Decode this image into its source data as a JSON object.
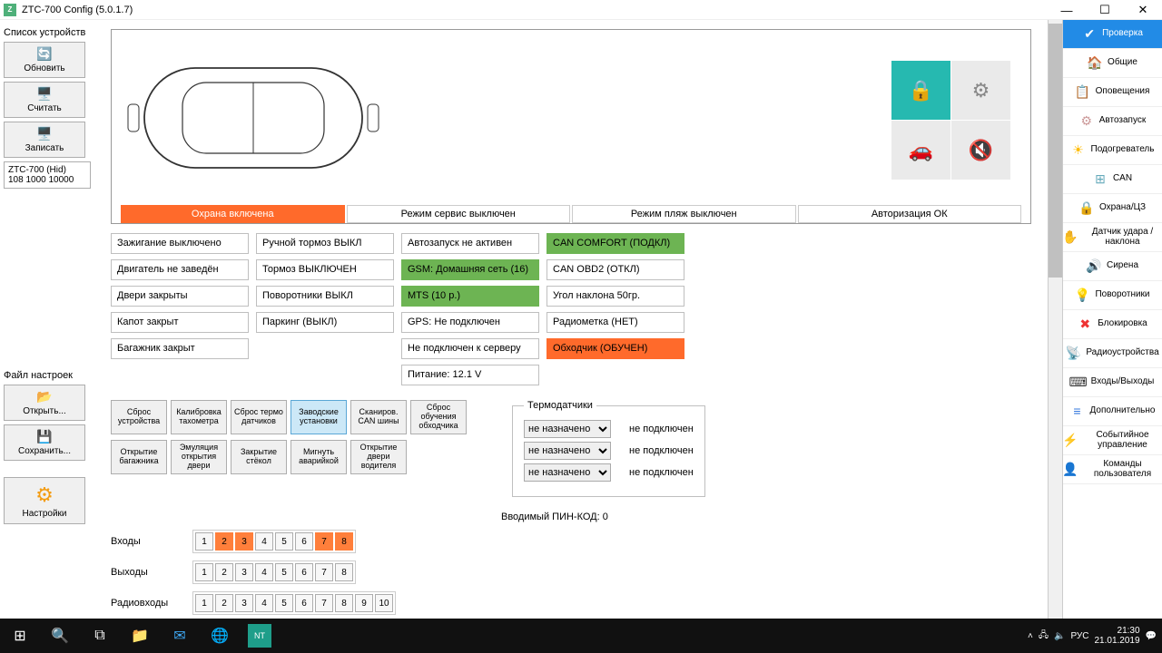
{
  "title": "ZTC-700 Config  (5.0.1.7)",
  "left": {
    "devices_label": "Список устройств",
    "refresh": "Обновить",
    "read": "Считать",
    "write": "Записать",
    "device_line1": "ZTC-700  (Hid)",
    "device_line2": "108 1000 10000",
    "settings_file": "Файл настроек",
    "open": "Открыть...",
    "save": "Сохранить...",
    "settings": "Настройки"
  },
  "tiles": {
    "lock": "🔒",
    "engine": "⚙",
    "car": "🚗",
    "mute": "🔇"
  },
  "status_strip": [
    "Охрана включена",
    "Режим сервис выключен",
    "Режим пляж выключен",
    "Авторизация ОК"
  ],
  "grid": {
    "c0": [
      "Зажигание выключено",
      "Двигатель не заведён",
      "Двери закрыты",
      "Капот закрыт",
      "Багажник закрыт"
    ],
    "c1": [
      "Ручной тормоз ВЫКЛ",
      "Тормоз ВЫКЛЮЧЕН",
      "Поворотники ВЫКЛ",
      "Паркинг (ВЫКЛ)"
    ],
    "c2": [
      "Автозапуск не активен",
      "GSM: Домашняя сеть (16)",
      "MTS (10 р.)",
      "GPS: Не подключен",
      "Не подключен к серверу",
      "Питание: 12.1 V"
    ],
    "c3": [
      "CAN COMFORT (ПОДКЛ)",
      "CAN OBD2 (ОТКЛ)",
      "Угол наклона 50гр.",
      "Радиометка (НЕТ)",
      "Обходчик (ОБУЧЕН)"
    ]
  },
  "actions": {
    "row1": [
      "Сброс устройства",
      "Калибровка тахометра",
      "Сброс термо датчиков",
      "Заводские установки",
      "Сканиров. CAN шины",
      "Сброс обучения обходчика"
    ],
    "row2": [
      "Открытие багажника",
      "Эмуляция открытия двери",
      "Закрытие стёкол",
      "Мигнуть аварийкой",
      "Открытие двери водителя"
    ]
  },
  "thermo": {
    "title": "Термодатчики",
    "option": "не назначено",
    "value": "не подключен"
  },
  "pin_label": "Вводимый ПИН-КОД: 0",
  "io": {
    "inputs": "Входы",
    "outputs": "Выходы",
    "radio": "Радиовходы",
    "in_states": [
      0,
      1,
      1,
      0,
      0,
      0,
      1,
      1
    ],
    "out_states": [
      0,
      0,
      0,
      0,
      0,
      0,
      0,
      0
    ],
    "radio_count": 10
  },
  "right_nav": [
    {
      "label": "Проверка",
      "icon": "✔",
      "active": true,
      "color": "#fff"
    },
    {
      "label": "Общие",
      "icon": "🏠",
      "color": "#e08"
    },
    {
      "label": "Оповещения",
      "icon": "📋",
      "color": "#59a"
    },
    {
      "label": "Автозапуск",
      "icon": "⚙",
      "color": "#c99"
    },
    {
      "label": "Подогреватель",
      "icon": "☀",
      "color": "#fb0"
    },
    {
      "label": "CAN",
      "icon": "⊞",
      "color": "#6ab"
    },
    {
      "label": "Охрана/ЦЗ",
      "icon": "🔒",
      "color": "#f90"
    },
    {
      "label": "Датчик удара / наклона",
      "icon": "✋",
      "color": "#eca"
    },
    {
      "label": "Сирена",
      "icon": "🔊",
      "color": "#6ab"
    },
    {
      "label": "Поворотники",
      "icon": "💡",
      "color": "#fc0"
    },
    {
      "label": "Блокировка",
      "icon": "✖",
      "color": "#e33"
    },
    {
      "label": "Радиоустройства",
      "icon": "📡",
      "color": "#555"
    },
    {
      "label": "Входы/Выходы",
      "icon": "⌨",
      "color": "#333"
    },
    {
      "label": "Дополнительно",
      "icon": "≡",
      "color": "#37d"
    },
    {
      "label": "Событийное управление",
      "icon": "⚡",
      "color": "#fc0"
    },
    {
      "label": "Команды пользователя",
      "icon": "👤",
      "color": "#c99"
    }
  ],
  "taskbar": {
    "lang": "РУС",
    "time": "21:30",
    "date": "21.01.2019"
  }
}
